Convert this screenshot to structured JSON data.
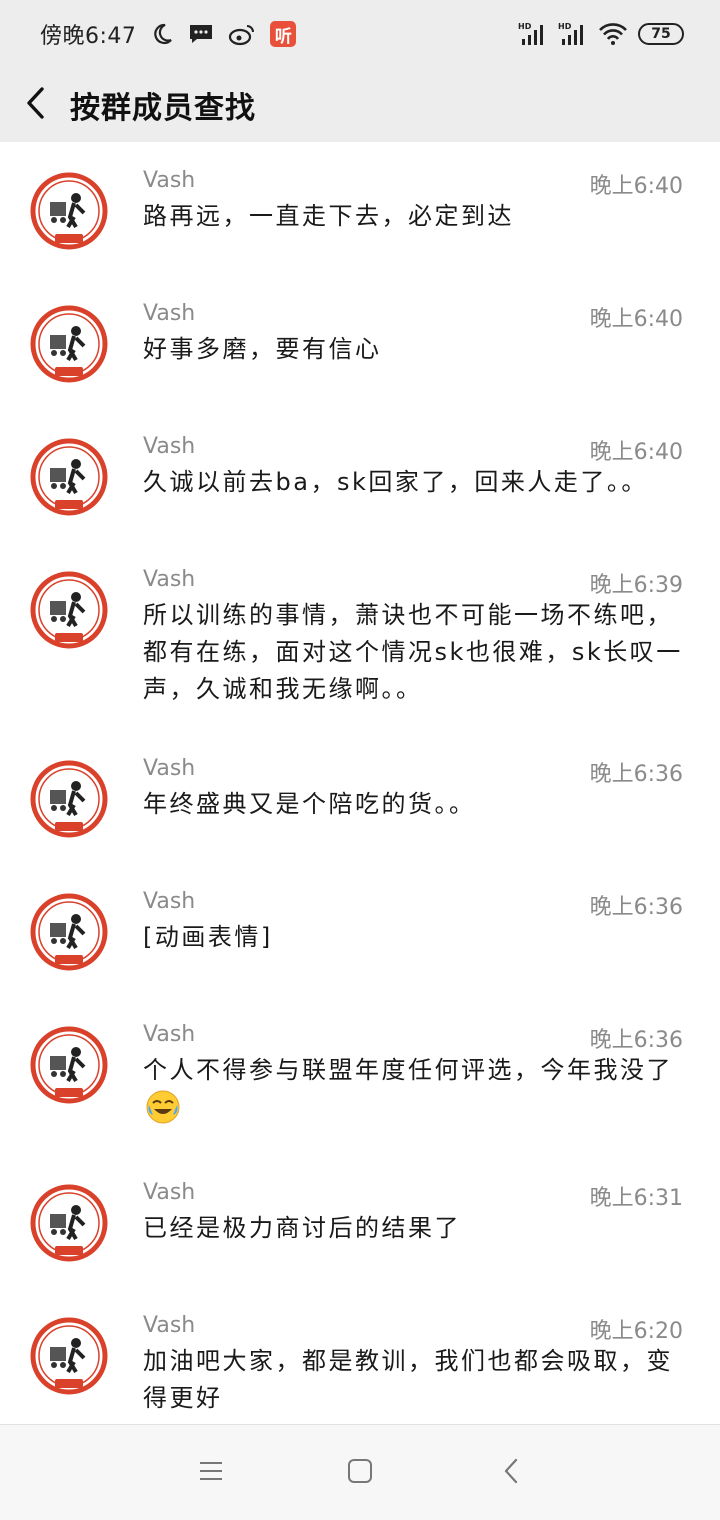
{
  "status_bar": {
    "time": "傍晚6:47",
    "listen_label": "听",
    "battery": "75",
    "icons": [
      "moon-icon",
      "message-icon",
      "weibo-icon",
      "listen-icon",
      "hd-signal-icon",
      "hd-signal-icon",
      "wifi-icon",
      "battery-icon"
    ]
  },
  "header": {
    "title": "按群成员查找",
    "back_icon": "chevron-left-icon"
  },
  "messages": [
    {
      "sender": "Vash",
      "time": "晚上6:40",
      "text": "路再远，一直走下去，必定到达"
    },
    {
      "sender": "Vash",
      "time": "晚上6:40",
      "text": "好事多磨，要有信心"
    },
    {
      "sender": "Vash",
      "time": "晚上6:40",
      "text": "久诚以前去ba，sk回家了，回来人走了。。"
    },
    {
      "sender": "Vash",
      "time": "晚上6:39",
      "text": "所以训练的事情，萧诀也不可能一场不练吧，都有在练，面对这个情况sk也很难，sk长叹一声，久诚和我无缘啊。。"
    },
    {
      "sender": "Vash",
      "time": "晚上6:36",
      "text": "年终盛典又是个陪吃的货。。"
    },
    {
      "sender": "Vash",
      "time": "晚上6:36",
      "text": "[动画表情]"
    },
    {
      "sender": "Vash",
      "time": "晚上6:36",
      "text": "个人不得参与联盟年度任何评选，今年我没了",
      "emoji": "crying-laughing-emoji"
    },
    {
      "sender": "Vash",
      "time": "晚上6:31",
      "text": "已经是极力商讨后的结果了"
    },
    {
      "sender": "Vash",
      "time": "晚上6:20",
      "text": "加油吧大家，都是教训，我们也都会吸取，变得更好"
    }
  ],
  "nav_bar": {
    "icons": [
      "menu-icon",
      "home-icon",
      "back-icon"
    ]
  },
  "colors": {
    "bar_bg": "#ededed",
    "avatar_red": "#d9412b",
    "text_secondary": "#8a8a8a"
  }
}
